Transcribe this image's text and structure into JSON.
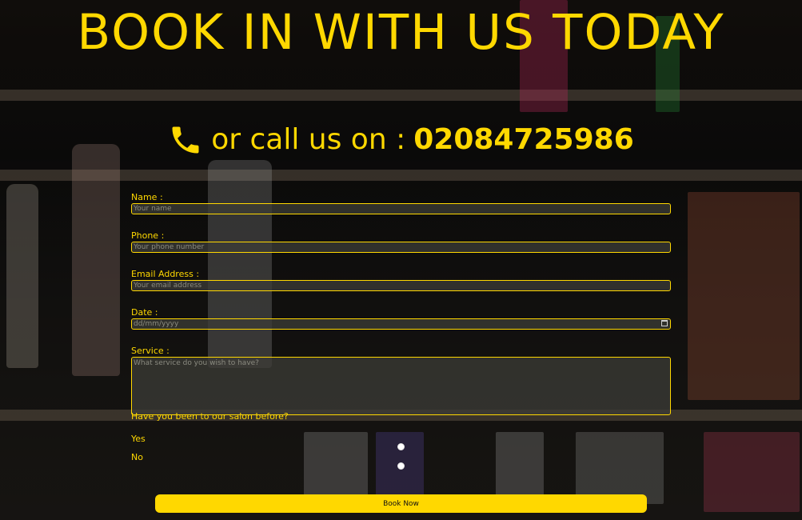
{
  "heading": "BOOK IN WITH US TODAY",
  "call": {
    "icon": "phone-icon",
    "text": "or call us on :",
    "number": "02084725986"
  },
  "form": {
    "name_label": "Name :",
    "name_placeholder": "Your name",
    "phone_label": "Phone :",
    "phone_placeholder": "Your phone number",
    "email_label": "Email Address :",
    "email_placeholder": "Your email address",
    "date_label": "Date :",
    "date_placeholder": "dd/mm/yyyy",
    "service_label": "Service :",
    "service_placeholder": "What service do you wish to have?",
    "question": "Have you been to our salon before?",
    "options": [
      "Yes",
      "No"
    ],
    "submit_label": "Book Now"
  },
  "colors": {
    "accent": "#ffd800",
    "field_background": "#3c3c37",
    "button_text": "#111111"
  }
}
